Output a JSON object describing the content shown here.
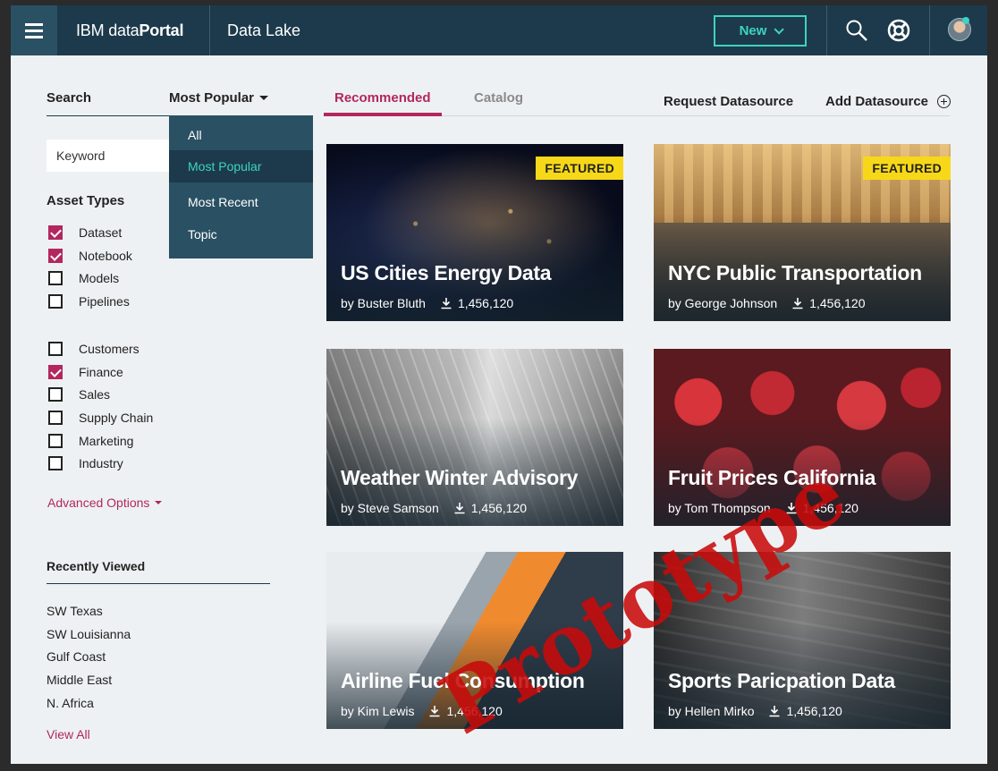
{
  "header": {
    "brand_prefix": "IBM data",
    "brand_bold": "Portal",
    "section": "Data Lake",
    "new_label": "New"
  },
  "filters": {
    "search_tab": "Search",
    "sort_label": "Most Popular",
    "keyword_placeholder": "Keyword",
    "sort_options": [
      "All",
      "Most Popular",
      "Most Recent",
      "Topic"
    ],
    "asset_types_title": "Asset Types",
    "asset_types": [
      {
        "label": "Dataset",
        "checked": true
      },
      {
        "label": "Notebook",
        "checked": true
      },
      {
        "label": "Models",
        "checked": false
      },
      {
        "label": "Pipelines",
        "checked": false
      }
    ],
    "categories": [
      {
        "label": "Customers",
        "checked": false
      },
      {
        "label": "Finance",
        "checked": true
      },
      {
        "label": "Sales",
        "checked": false
      },
      {
        "label": "Supply Chain",
        "checked": false
      },
      {
        "label": "Marketing",
        "checked": false
      },
      {
        "label": "Industry",
        "checked": false
      }
    ],
    "advanced_options": "Advanced Options"
  },
  "recently_viewed": {
    "title": "Recently Viewed",
    "items": [
      "SW Texas",
      "SW Louisianna",
      "Gulf Coast",
      "Middle East",
      "N. Africa"
    ],
    "view_all": "View All"
  },
  "main": {
    "tabs": [
      "Recommended",
      "Catalog"
    ],
    "request_datasource": "Request Datasource",
    "add_datasource": "Add Datasource",
    "featured_label": "FEATURED",
    "cards": [
      {
        "title": "US Cities Energy Data",
        "author": "by Buster Bluth",
        "downloads": "1,456,120",
        "featured": true
      },
      {
        "title": "NYC Public Transportation",
        "author": "by George Johnson",
        "downloads": "1,456,120",
        "featured": true
      },
      {
        "title": "Weather Winter Advisory",
        "author": "by Steve Samson",
        "downloads": "1,456,120",
        "featured": false
      },
      {
        "title": "Fruit Prices California",
        "author": "by Tom Thompson",
        "downloads": "1,456,120",
        "featured": false
      },
      {
        "title": "Airline Fuel Consumption",
        "author": "by Kim Lewis",
        "downloads": "1,456,120",
        "featured": false
      },
      {
        "title": "Sports Paricpation Data",
        "author": "by Hellen Mirko",
        "downloads": "1,456,120",
        "featured": false
      }
    ]
  },
  "watermark": "Prototype",
  "colors": {
    "topbar": "#1c3a4b",
    "accent_teal": "#3ed3c3",
    "accent_magenta": "#b2275f",
    "featured_yellow": "#f7d818"
  }
}
